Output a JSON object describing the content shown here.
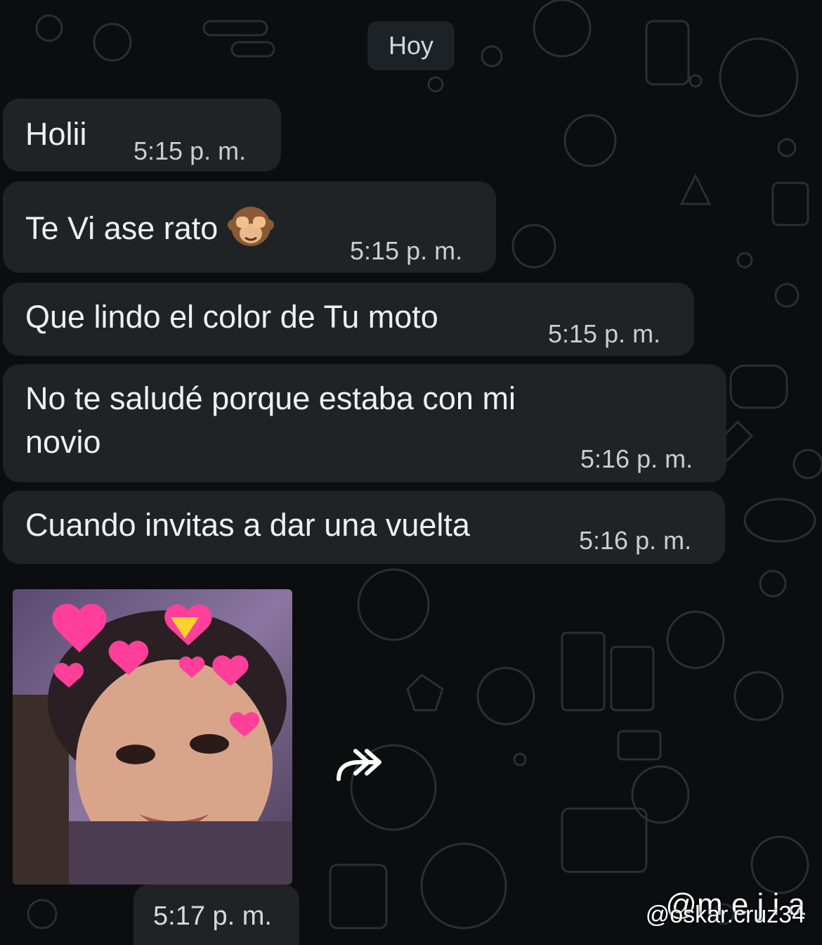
{
  "chat": {
    "date_label": "Hoy",
    "messages": [
      {
        "text": "Holii",
        "time": "5:15 p. m."
      },
      {
        "text": "Te Vi ase rato",
        "emoji": "see-no-evil-monkey",
        "time": "5:15 p. m."
      },
      {
        "text": "Que lindo el color de Tu moto",
        "time": "5:15 p. m."
      },
      {
        "text_line1": "No te saludé porque estaba con mi",
        "text_line2": "novio",
        "time": "5:16 p. m."
      },
      {
        "text": "Cuando invitas a dar una vuelta",
        "time": "5:16 p. m."
      }
    ],
    "image_message": {
      "time": "5:17 p. m.",
      "description_icon": "photo-sticker"
    },
    "forward_icon": "forward-icon"
  },
  "overlay": {
    "watermark_primary": "@m e j i a",
    "watermark_secondary": "@oskar.cruz34"
  },
  "colors": {
    "background": "#0b0d0e",
    "bubble": "#1f2326",
    "text": "#eef1f2",
    "time_text": "#c9ced1"
  }
}
